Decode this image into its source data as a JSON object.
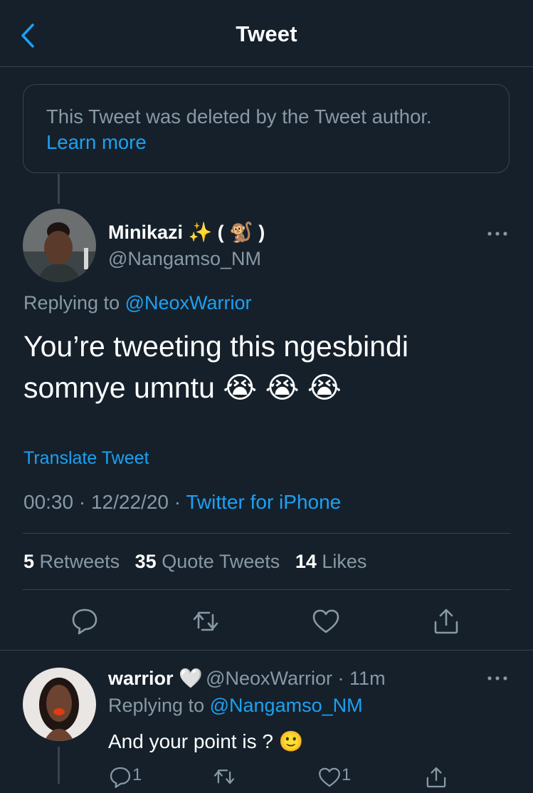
{
  "header": {
    "title": "Tweet"
  },
  "deleted_notice": {
    "text": "This Tweet was deleted by the Tweet author.",
    "link": "Learn more"
  },
  "tweet": {
    "name": "Minikazi ✨ ( 🐒 )",
    "handle": "@Nangamso_NM",
    "replying_prefix": "Replying to",
    "replying_handle": "@NeoxWarrior",
    "text_line1": "You’re tweeting this ngesbindi",
    "text_line2": "somnye umntu 😭 😭 😭",
    "translate": "Translate Tweet",
    "time": "00:30",
    "date": "12/22/20",
    "source": "Twitter for iPhone",
    "stats": {
      "retweets": "5",
      "retweets_label": "Retweets",
      "quotes": "35",
      "quotes_label": "Quote Tweets",
      "likes": "14",
      "likes_label": "Likes"
    }
  },
  "reply": {
    "name": "warrior 🤍",
    "handle": "@NeoxWarrior",
    "time": "11m",
    "replying_prefix": "Replying to",
    "replying_handle": "@Nangamso_NM",
    "text": "And your point is ? 🙂",
    "reply_count": "1",
    "like_count": "1"
  },
  "colors": {
    "accent": "#1da1f2",
    "background": "#15202b",
    "secondary_text": "#8899a6",
    "border": "#38444d"
  }
}
